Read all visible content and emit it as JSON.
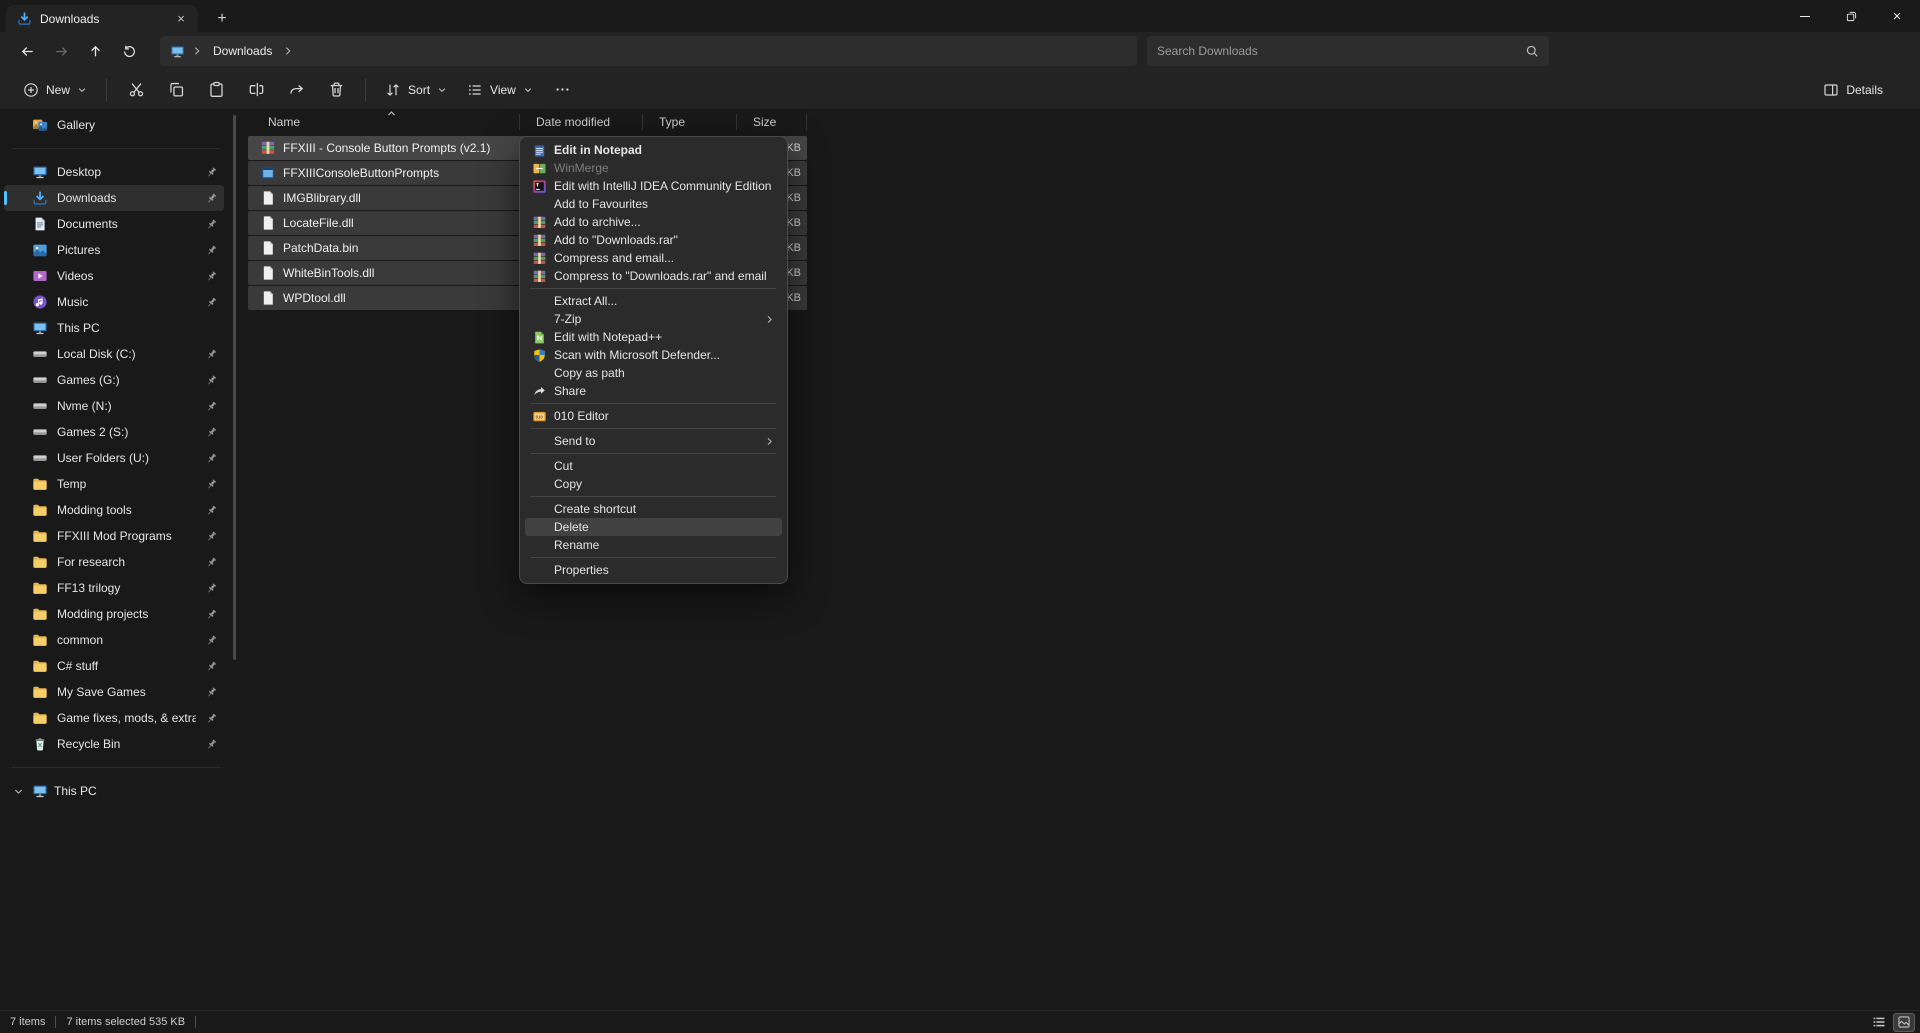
{
  "window": {
    "tab_title": "Downloads"
  },
  "navbar": {
    "breadcrumb": [
      "Downloads"
    ],
    "search_placeholder": "Search Downloads"
  },
  "toolbar": {
    "new_label": "New",
    "sort_label": "Sort",
    "view_label": "View",
    "details_label": "Details"
  },
  "sidebar": {
    "sections": [
      {
        "name": "home",
        "items": [
          {
            "label": "Gallery",
            "icon": "gallery-icon"
          }
        ]
      },
      {
        "name": "pinned",
        "items": [
          {
            "label": "Desktop",
            "icon": "desktop-icon",
            "pinned": true
          },
          {
            "label": "Downloads",
            "icon": "downloads-icon",
            "pinned": true,
            "selected": true
          },
          {
            "label": "Documents",
            "icon": "documents-icon",
            "pinned": true
          },
          {
            "label": "Pictures",
            "icon": "pictures-icon",
            "pinned": true
          },
          {
            "label": "Videos",
            "icon": "videos-icon",
            "pinned": true
          },
          {
            "label": "Music",
            "icon": "music-icon",
            "pinned": true
          },
          {
            "label": "This PC",
            "icon": "pc-icon"
          },
          {
            "label": "Local Disk (C:)",
            "icon": "drive-icon",
            "pinned": true
          },
          {
            "label": "Games (G:)",
            "icon": "drive-icon",
            "pinned": true
          },
          {
            "label": "Nvme (N:)",
            "icon": "drive-icon",
            "pinned": true
          },
          {
            "label": "Games 2 (S:)",
            "icon": "drive-icon",
            "pinned": true
          },
          {
            "label": "User Folders (U:)",
            "icon": "drive-icon",
            "pinned": true
          },
          {
            "label": "Temp",
            "icon": "folder-icon",
            "pinned": true
          },
          {
            "label": "Modding tools",
            "icon": "folder-icon",
            "pinned": true
          },
          {
            "label": "FFXIII Mod Programs",
            "icon": "folder-icon",
            "pinned": true
          },
          {
            "label": "For research",
            "icon": "folder-icon",
            "pinned": true
          },
          {
            "label": "FF13 trilogy",
            "icon": "folder-icon",
            "pinned": true
          },
          {
            "label": "Modding projects",
            "icon": "folder-icon",
            "pinned": true
          },
          {
            "label": "common",
            "icon": "folder-icon",
            "pinned": true
          },
          {
            "label": "C# stuff",
            "icon": "folder-icon",
            "pinned": true
          },
          {
            "label": "My Save Games",
            "icon": "folder-icon",
            "pinned": true
          },
          {
            "label": "Game fixes, mods, & extras",
            "icon": "folder-icon",
            "pinned": true
          },
          {
            "label": "Recycle Bin",
            "icon": "recycle-bin-icon",
            "pinned": true
          }
        ]
      },
      {
        "name": "tree",
        "items": [
          {
            "label": "This PC",
            "icon": "pc-icon",
            "expandable": true
          }
        ]
      }
    ]
  },
  "file_list": {
    "columns": [
      {
        "label": "Name",
        "sorted": "asc"
      },
      {
        "label": "Date modified"
      },
      {
        "label": "Type"
      },
      {
        "label": "Size"
      }
    ],
    "rows": [
      {
        "name": "FFXIII - Console Button Prompts (v2.1)",
        "icon": "winrar-icon",
        "size": "KB",
        "selected": true,
        "focused": true
      },
      {
        "name": "FFXIIIConsoleButtonPrompts",
        "icon": "app-icon",
        "size": "KB",
        "selected": true
      },
      {
        "name": "IMGBlibrary.dll",
        "icon": "file-icon",
        "size": "KB",
        "selected": true
      },
      {
        "name": "LocateFile.dll",
        "icon": "file-icon",
        "size": "KB",
        "selected": true
      },
      {
        "name": "PatchData.bin",
        "icon": "file-icon",
        "size": "KB",
        "selected": true
      },
      {
        "name": "WhiteBinTools.dll",
        "icon": "file-icon",
        "size": "KB",
        "selected": true
      },
      {
        "name": "WPDtool.dll",
        "icon": "file-icon",
        "size": "KB",
        "selected": true
      }
    ]
  },
  "context_menu": {
    "groups": [
      {
        "items": [
          {
            "label": "Edit in Notepad",
            "icon": "notepad-icon",
            "bold": true
          },
          {
            "label": "WinMerge",
            "icon": "winmerge-icon",
            "disabled": true
          },
          {
            "label": "Edit with IntelliJ IDEA Community Edition",
            "icon": "intellij-icon"
          },
          {
            "label": "Add to Favourites"
          },
          {
            "label": "Add to archive...",
            "icon": "winrar-icon"
          },
          {
            "label": "Add to \"Downloads.rar\"",
            "icon": "winrar-icon"
          },
          {
            "label": "Compress and email...",
            "icon": "winrar-icon"
          },
          {
            "label": "Compress to \"Downloads.rar\" and email",
            "icon": "winrar-icon"
          }
        ]
      },
      {
        "items": [
          {
            "label": "Extract All..."
          },
          {
            "label": "7-Zip",
            "submenu": true
          },
          {
            "label": "Edit with Notepad++",
            "icon": "notepadpp-icon"
          },
          {
            "label": "Scan with Microsoft Defender...",
            "icon": "defender-icon"
          },
          {
            "label": "Copy as path"
          },
          {
            "label": "Share",
            "icon": "share-icon"
          }
        ]
      },
      {
        "items": [
          {
            "label": "010 Editor",
            "icon": "010-editor-icon"
          }
        ]
      },
      {
        "items": [
          {
            "label": "Send to",
            "submenu": true
          }
        ]
      },
      {
        "items": [
          {
            "label": "Cut"
          },
          {
            "label": "Copy"
          }
        ]
      },
      {
        "items": [
          {
            "label": "Create shortcut"
          },
          {
            "label": "Delete",
            "highlighted": true
          },
          {
            "label": "Rename"
          }
        ]
      },
      {
        "items": [
          {
            "label": "Properties"
          }
        ]
      }
    ]
  },
  "status_bar": {
    "items_text": "7 items",
    "selection_text": "7 items selected 535 KB"
  }
}
